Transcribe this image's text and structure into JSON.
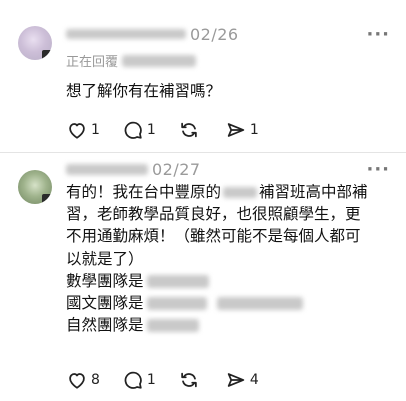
{
  "posts": [
    {
      "date": "02/26",
      "replying_label": "正在回覆",
      "lines": [
        "想了解你有在補習嗎？"
      ],
      "actions": {
        "likes": "1",
        "comments": "1",
        "reposts": "",
        "shares": "1"
      }
    },
    {
      "date": "02/27",
      "lines": [
        "有的！我在台中豐原的",
        "補習班高中部補",
        "習，老師教學品質良好，也很照顧學生，更",
        "不用通勤麻煩！（雖然可能不是每個人都可",
        "以就是了）",
        "數學團隊是",
        "國文團隊是",
        "自然團隊是"
      ],
      "actions": {
        "likes": "8",
        "comments": "1",
        "reposts": "",
        "shares": "4"
      }
    }
  ],
  "icons": {
    "like": "heart-icon",
    "comment": "comment-icon",
    "repost": "repost-icon",
    "share": "share-icon",
    "more": "more-icon"
  },
  "colors": {
    "text": "#111111",
    "muted": "#9a9a9a",
    "divider": "#e4e4e4"
  }
}
